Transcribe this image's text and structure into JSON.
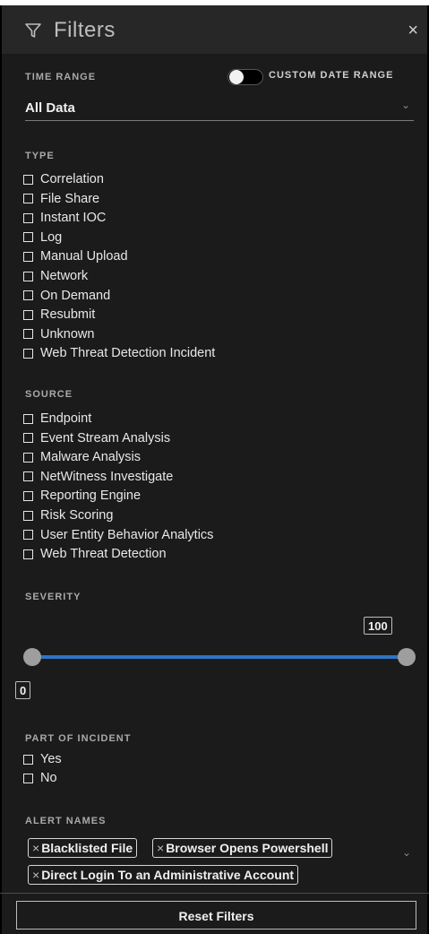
{
  "header": {
    "title": "Filters",
    "close_glyph": "×",
    "filter_icon": "funnel-icon"
  },
  "time_range": {
    "label": "TIME RANGE",
    "toggle_label": "CUSTOM DATE RANGE",
    "toggle_on": false,
    "selected": "All Data"
  },
  "type": {
    "label": "TYPE",
    "items": [
      "Correlation",
      "File Share",
      "Instant IOC",
      "Log",
      "Manual Upload",
      "Network",
      "On Demand",
      "Resubmit",
      "Unknown",
      "Web Threat Detection Incident"
    ]
  },
  "source": {
    "label": "SOURCE",
    "items": [
      "Endpoint",
      "Event Stream Analysis",
      "Malware Analysis",
      "NetWitness Investigate",
      "Reporting Engine",
      "Risk Scoring",
      "User Entity Behavior Analytics",
      "Web Threat Detection"
    ]
  },
  "severity": {
    "label": "SEVERITY",
    "min": "0",
    "max": "100",
    "accent": "#2f74c4"
  },
  "incident": {
    "label": "PART OF INCIDENT",
    "items": [
      "Yes",
      "No"
    ]
  },
  "alert_names": {
    "label": "ALERT NAMES",
    "remove_glyph": "×",
    "tags": [
      "Blacklisted File",
      "Browser Opens Powershell",
      "Direct Login To an Administrative Account"
    ]
  },
  "footer": {
    "reset_label": "Reset Filters"
  }
}
